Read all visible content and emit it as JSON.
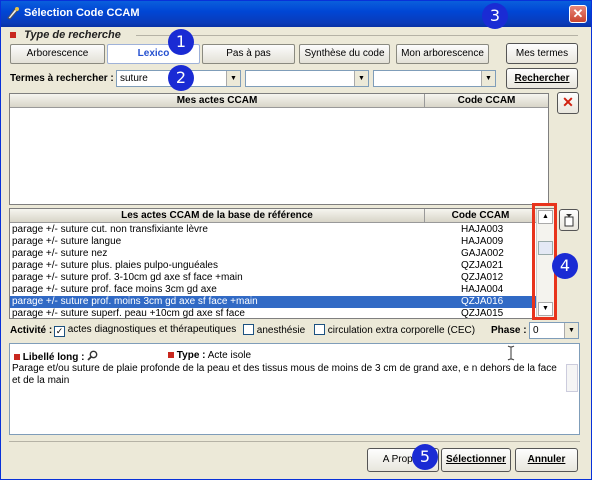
{
  "window": {
    "title": "Sélection Code CCAM",
    "close_glyph": "✕"
  },
  "search_type": {
    "title": "Type de recherche"
  },
  "tabs": [
    {
      "label": "Arborescence"
    },
    {
      "label": "Lexico"
    },
    {
      "label": "Pas à pas"
    },
    {
      "label": "Synthèse du code"
    },
    {
      "label": "Mon arborescence"
    },
    {
      "label": "Mes termes"
    }
  ],
  "search": {
    "label": "Termes à rechercher :",
    "term1": "suture",
    "term2": "",
    "term3": "",
    "button": "Rechercher"
  },
  "my_acts": {
    "col_libelle": "Mes actes CCAM",
    "col_code": "Code CCAM",
    "delete_glyph": "✕"
  },
  "base_acts": {
    "col_libelle": "Les actes CCAM de la base de référence",
    "col_code": "Code CCAM",
    "rows": [
      {
        "libelle": "parage +/- suture cut. non transfixiante lèvre",
        "code": "HAJA003"
      },
      {
        "libelle": "parage +/- suture langue",
        "code": "HAJA009"
      },
      {
        "libelle": "parage +/- suture nez",
        "code": "GAJA002"
      },
      {
        "libelle": "parage +/- suture plus. plaies pulpo-unguéales",
        "code": "QZJA021"
      },
      {
        "libelle": "parage +/- suture prof. 3-10cm gd axe sf face +main",
        "code": "QZJA012"
      },
      {
        "libelle": "parage +/- suture prof. face moins 3cm gd axe",
        "code": "HAJA004"
      },
      {
        "libelle": "parage +/- suture prof. moins 3cm gd axe sf face +main",
        "code": "QZJA016"
      },
      {
        "libelle": "parage +/- suture superf. peau +10cm gd axe sf face",
        "code": "QZJA015"
      }
    ],
    "selected_index": 6,
    "scroll_position": 0.25
  },
  "activity": {
    "label": "Activité :",
    "options": [
      {
        "label": "actes diagnostiques et thérapeutiques",
        "checked": true
      },
      {
        "label": "anesthésie",
        "checked": false
      },
      {
        "label": "circulation extra corporelle (CEC)",
        "checked": false
      }
    ],
    "phase_label": "Phase :",
    "phase_value": "0"
  },
  "details": {
    "libelle_label": "Libellé long :",
    "type_label": "Type :",
    "type_value": "Acte isole",
    "text": "Parage et/ou suture de plaie profonde de la peau et des tissus mous de moins de 3 cm de grand axe, e n dehors de la face et de la main"
  },
  "footer": {
    "apropos": "A Propos",
    "select": "Sélectionner",
    "cancel": "Annuler"
  },
  "callouts": [
    "1",
    "2",
    "3",
    "4",
    "5"
  ],
  "icons": {
    "app": "app-icon",
    "close": "close-icon",
    "delete": "delete-icon",
    "add": "add-to-my-acts-icon",
    "magnifier": "magnifier-icon",
    "cursor": "text-cursor-icon"
  },
  "colors": {
    "title_bar": "#0a4fd6",
    "selection": "#316ac5",
    "accent_red": "#c8281e",
    "callout": "#1a2bd4",
    "highlight_box": "#e8341c"
  }
}
